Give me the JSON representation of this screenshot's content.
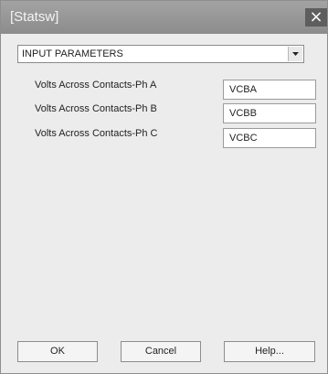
{
  "window": {
    "title": "[Statsw]",
    "close_icon": "close-icon"
  },
  "dropdown": {
    "selected": "INPUT PARAMETERS",
    "arrow_icon": "chevron-down-icon"
  },
  "parameters": [
    {
      "label": "Volts Across Contacts-Ph A",
      "value": "VCBA"
    },
    {
      "label": "Volts Across Contacts-Ph B",
      "value": "VCBB"
    },
    {
      "label": "Volts Across Contacts-Ph C",
      "value": "VCBC"
    }
  ],
  "buttons": {
    "ok": "OK",
    "cancel": "Cancel",
    "help": "Help..."
  }
}
